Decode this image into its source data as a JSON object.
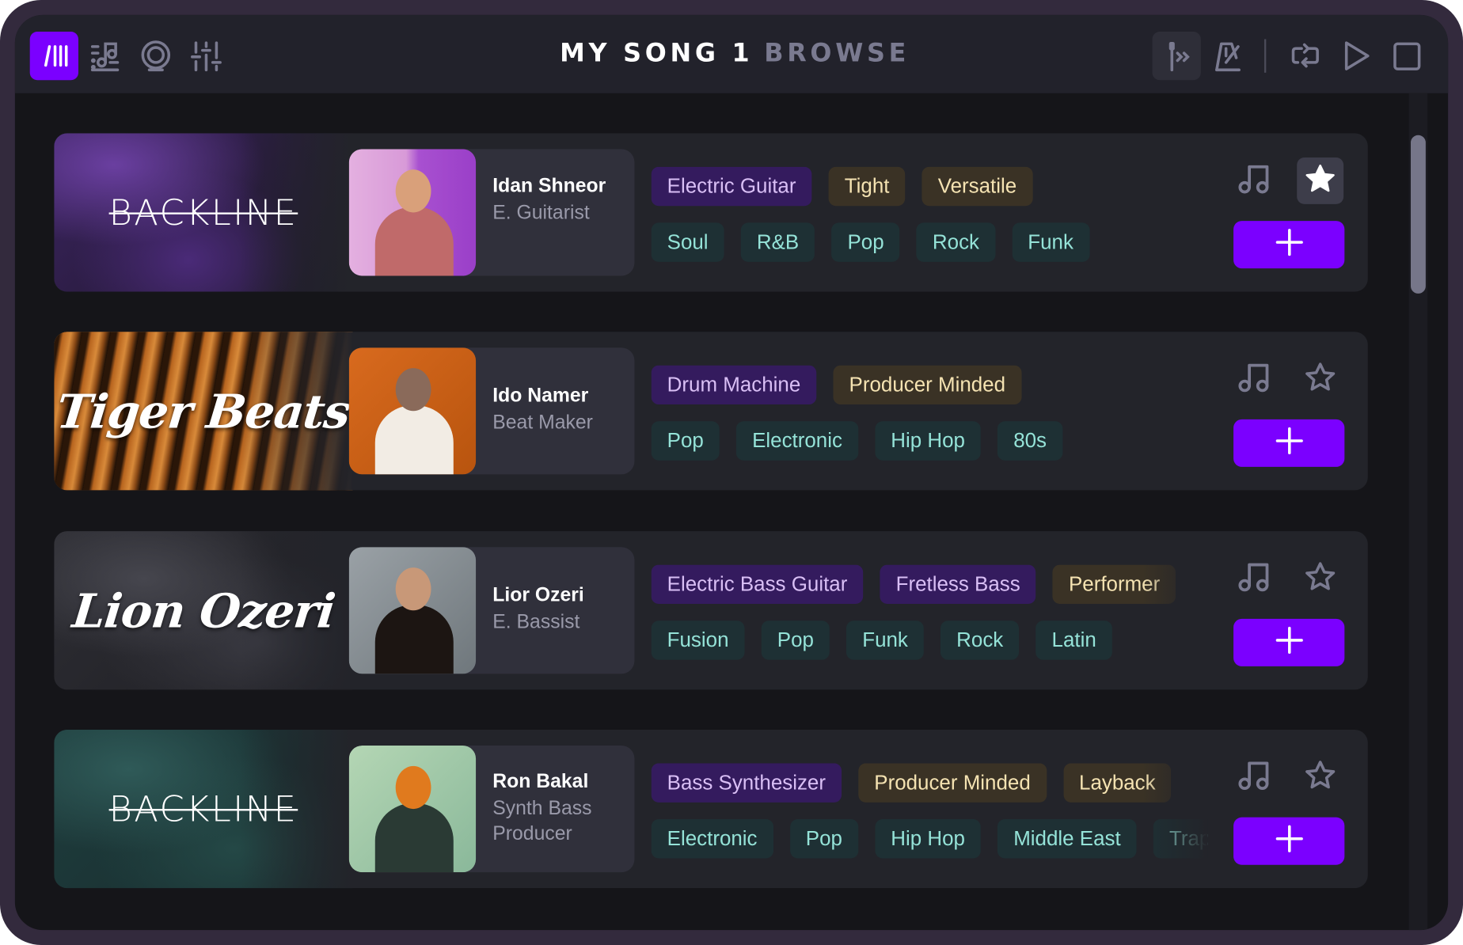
{
  "topbar": {
    "left_icons": [
      {
        "name": "tracks-icon",
        "active": true
      },
      {
        "name": "music-library-icon",
        "active": false
      },
      {
        "name": "recording-icon",
        "active": false
      },
      {
        "name": "mixer-icon",
        "active": false
      }
    ],
    "song_title": "MY SONG 1",
    "browse_label": "BROWSE",
    "right_icons": [
      "count-in-icon",
      "metronome-icon",
      "loop-icon",
      "play-icon",
      "stop-icon"
    ]
  },
  "colors": {
    "accent": "#7b00ff",
    "instrument_tag_bg": "#341b5e",
    "instrument_tag_text": "#d9bff5",
    "trait_tag_bg": "#3a3225",
    "trait_tag_text": "#f5e3b2",
    "genre_tag_bg": "#1e3034",
    "genre_tag_text": "#95e3d8"
  },
  "artists": [
    {
      "brand": "BACKLINE",
      "name": "Idan Shneor",
      "role": "E. Guitarist",
      "instrument_tags": [
        "Electric Guitar"
      ],
      "trait_tags": [
        "Tight",
        "Versatile"
      ],
      "genre_tags": [
        "Soul",
        "R&B",
        "Pop",
        "Rock",
        "Funk"
      ],
      "favorited": true
    },
    {
      "brand": "Tiger Beats",
      "name": "Ido Namer",
      "role": "Beat Maker",
      "instrument_tags": [
        "Drum Machine"
      ],
      "trait_tags": [
        "Producer Minded"
      ],
      "genre_tags": [
        "Pop",
        "Electronic",
        "Hip Hop",
        "80s"
      ],
      "favorited": false
    },
    {
      "brand": "Lion Ozeri",
      "name": "Lior Ozeri",
      "role": "E. Bassist",
      "instrument_tags": [
        "Electric Bass Guitar",
        "Fretless Bass"
      ],
      "trait_tags": [
        "Performer"
      ],
      "genre_tags": [
        "Fusion",
        "Pop",
        "Funk",
        "Rock",
        "Latin"
      ],
      "favorited": false
    },
    {
      "brand": "BACKLINE",
      "name": "Ron Bakal",
      "role": "Synth Bass\nProducer",
      "instrument_tags": [
        "Bass Synthesizer"
      ],
      "trait_tags": [
        "Producer Minded",
        "Layback"
      ],
      "genre_tags": [
        "Electronic",
        "Pop",
        "Hip Hop",
        "Middle East",
        "Trap"
      ],
      "favorited": false
    }
  ],
  "actions": {
    "preview_icon": "music-notes-icon",
    "favorite_icon": "star-icon",
    "add_icon": "plus-icon"
  }
}
